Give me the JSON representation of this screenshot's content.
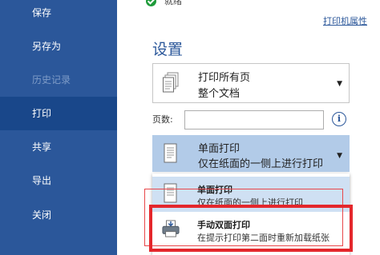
{
  "nav": {
    "items": [
      {
        "label": "保存"
      },
      {
        "label": "另存为"
      },
      {
        "label": "历史记录"
      },
      {
        "label": "打印"
      },
      {
        "label": "共享"
      },
      {
        "label": "导出"
      },
      {
        "label": "关闭"
      }
    ]
  },
  "printer": {
    "status": "就绪",
    "properties_link": "打印机属性"
  },
  "settings": {
    "title": "设置",
    "scope": {
      "line1": "打印所有页",
      "line2": "整个文档"
    },
    "pages_label": "页数:",
    "pages_value": "",
    "info_icon": "i",
    "sides": {
      "line1": "单面打印",
      "line2": "仅在纸面的一侧上进行打印"
    }
  },
  "sides_menu": {
    "items": [
      {
        "title": "单面打印",
        "desc": "仅在纸面的一侧上进行打印"
      },
      {
        "title": "手动双面打印",
        "desc": "在提示打印第二面时重新加载纸张"
      }
    ]
  },
  "colors": {
    "nav_bg": "#2b579a",
    "nav_active": "#19478a",
    "accent": "#2b579a",
    "selected_bg": "#b2cbe8",
    "hover_bg": "#cfe0f3",
    "highlight_red": "#e4272c"
  }
}
